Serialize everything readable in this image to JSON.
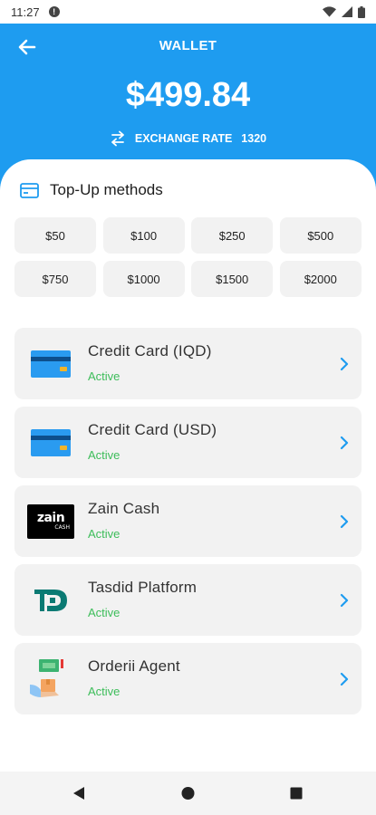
{
  "status_bar": {
    "time": "11:27"
  },
  "header": {
    "title": "WALLET",
    "balance": "$499.84",
    "exchange_rate_label": "EXCHANGE RATE",
    "exchange_rate_value": "1320"
  },
  "topup": {
    "title": "Top-Up methods",
    "amounts": [
      "$50",
      "$100",
      "$250",
      "$500",
      "$750",
      "$1000",
      "$1500",
      "$2000"
    ]
  },
  "methods": [
    {
      "name": "Credit Card (IQD)",
      "status": "Active",
      "icon": "credit-card-icon"
    },
    {
      "name": "Credit Card (USD)",
      "status": "Active",
      "icon": "credit-card-icon"
    },
    {
      "name": "Zain Cash",
      "status": "Active",
      "icon": "zain-cash-logo",
      "logo_text": "zain",
      "logo_subtext": "CASH"
    },
    {
      "name": "Tasdid Platform",
      "status": "Active",
      "icon": "tasdid-logo"
    },
    {
      "name": "Orderii Agent",
      "status": "Active",
      "icon": "agent-icon"
    }
  ],
  "colors": {
    "primary": "#1e9cf0",
    "active_status": "#3dbd5a",
    "card_bg": "#f2f2f2",
    "tasdid": "#0b7a73"
  }
}
